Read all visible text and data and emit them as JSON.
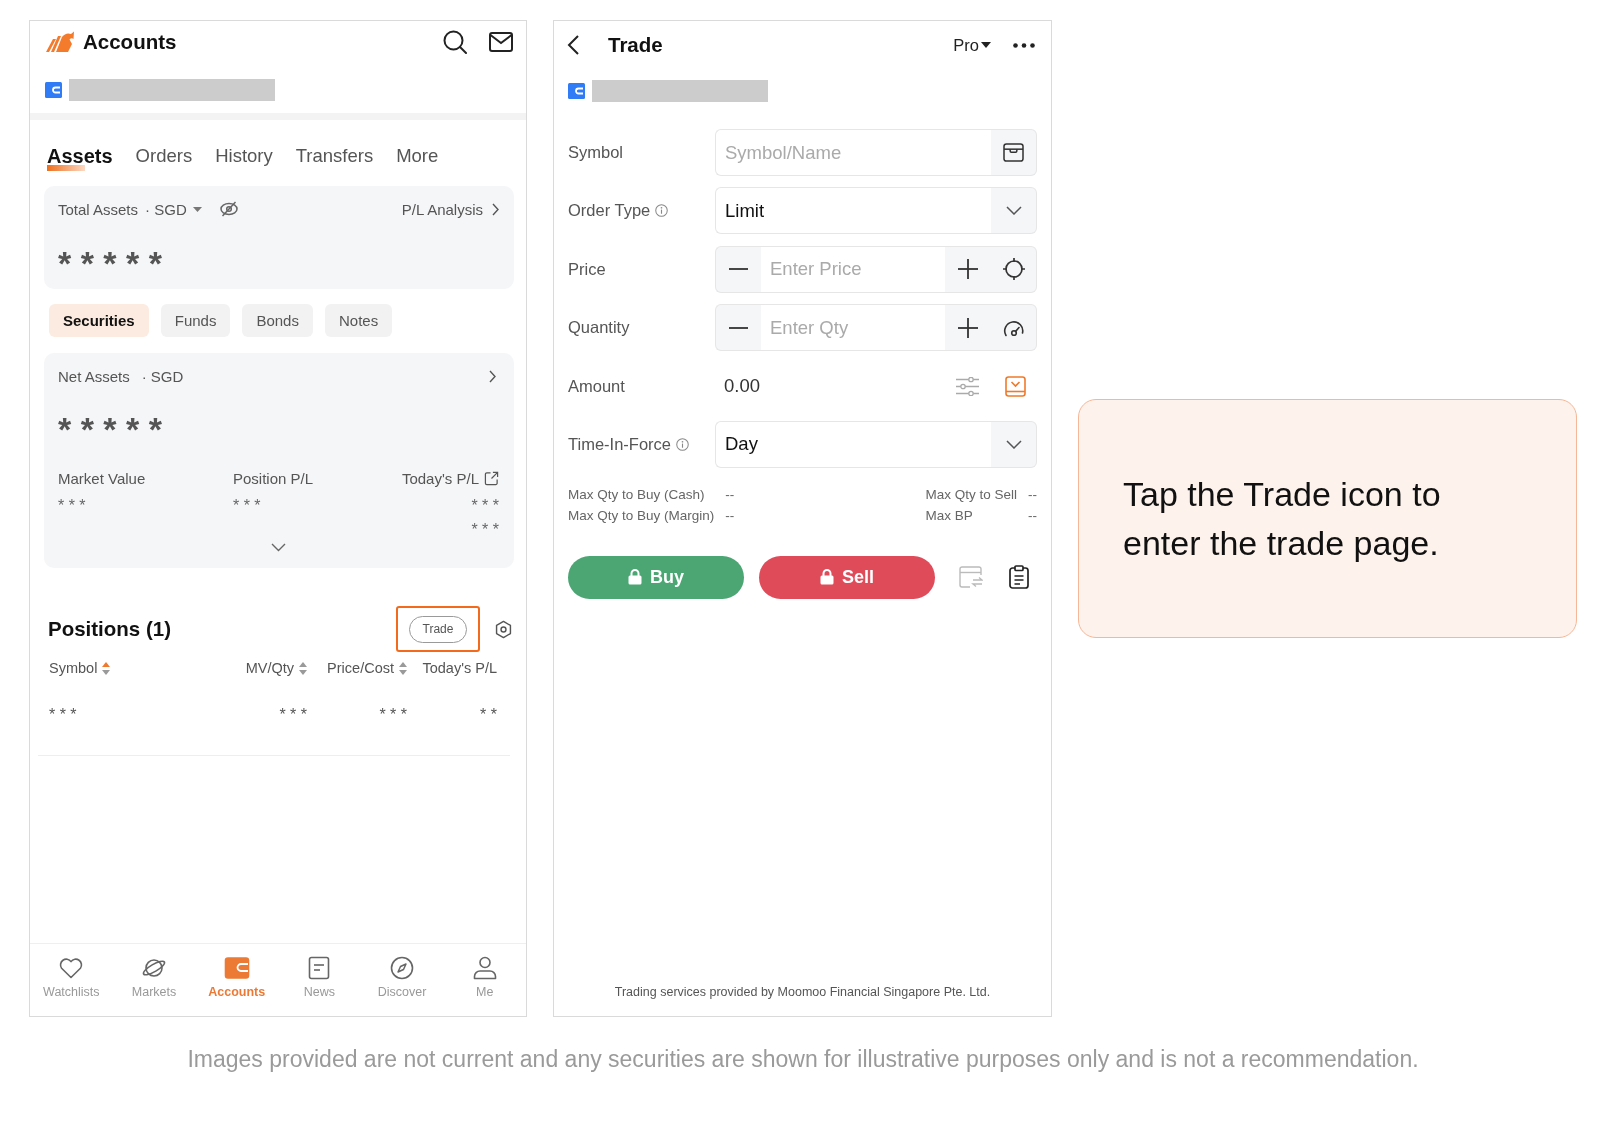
{
  "accounts_screen": {
    "title": "Accounts",
    "tabs": [
      {
        "label": "Assets",
        "selected": true
      },
      {
        "label": "Orders",
        "selected": false
      },
      {
        "label": "History",
        "selected": false
      },
      {
        "label": "Transfers",
        "selected": false
      },
      {
        "label": "More",
        "selected": false
      }
    ],
    "total_assets": {
      "label": "Total Assets",
      "currency": "· SGD",
      "link": "P/L Analysis",
      "value": "* * * * *"
    },
    "asset_types": [
      {
        "label": "Securities",
        "selected": true
      },
      {
        "label": "Funds",
        "selected": false
      },
      {
        "label": "Bonds",
        "selected": false
      },
      {
        "label": "Notes",
        "selected": false
      }
    ],
    "net_assets": {
      "label": "Net Assets",
      "currency": "· SGD",
      "value": "* * * * *",
      "metrics": [
        {
          "label": "Market Value",
          "values": [
            "* * *"
          ]
        },
        {
          "label": "Position P/L",
          "values": [
            "* * *"
          ]
        },
        {
          "label": "Today's P/L",
          "values": [
            "* * *",
            "* * *"
          ]
        }
      ]
    },
    "positions": {
      "title": "Positions (1)",
      "trade_button": {
        "label": "Trade",
        "highlighted": true
      },
      "columns": [
        {
          "label": "Symbol",
          "sortable": true,
          "sorted": true
        },
        {
          "label": "MV/Qty",
          "sortable": true,
          "sorted": false
        },
        {
          "label": "Price/Cost",
          "sortable": true,
          "sorted": false
        },
        {
          "label": "Today's P/L",
          "sortable": false
        }
      ],
      "rows": [
        [
          "* * *",
          "* * *",
          "* * *",
          "* *"
        ]
      ]
    },
    "tab_bar": [
      {
        "label": "Watchlists",
        "selected": false
      },
      {
        "label": "Markets",
        "selected": false
      },
      {
        "label": "Accounts",
        "selected": true
      },
      {
        "label": "News",
        "selected": false
      },
      {
        "label": "Discover",
        "selected": false
      },
      {
        "label": "Me",
        "selected": false
      }
    ]
  },
  "trade_screen": {
    "title": "Trade",
    "mode": "Pro",
    "form": [
      {
        "kind": "search",
        "label": "Symbol",
        "info": false,
        "placeholder": "Symbol/Name"
      },
      {
        "kind": "select",
        "label": "Order Type",
        "info": true,
        "value": "Limit"
      },
      {
        "kind": "price",
        "label": "Price",
        "info": false,
        "placeholder": "Enter Price"
      },
      {
        "kind": "quantity",
        "label": "Quantity",
        "info": false,
        "placeholder": "Enter Qty"
      },
      {
        "kind": "amount",
        "label": "Amount",
        "info": false,
        "value": "0.00"
      },
      {
        "kind": "select",
        "label": "Time-In-Force",
        "info": true,
        "value": "Day"
      }
    ],
    "limit_rows": [
      [
        "Max Qty to Buy (Cash)",
        "--",
        "Max Qty to Sell",
        "--"
      ],
      [
        "Max Qty to Buy (Margin)",
        "--",
        "Max BP",
        "--"
      ]
    ],
    "actions": [
      {
        "kind": "buy",
        "label": "Buy",
        "locked": true
      },
      {
        "kind": "sell",
        "label": "Sell",
        "locked": true
      }
    ],
    "footer": "Trading services provided by Moomoo Financial Singapore Pte. Ltd."
  },
  "callout": {
    "text": "Tap the Trade icon to enter the trade page."
  },
  "disclaimer": "Images provided are not current and any securities are shown for illustrative purposes only and is not a recommendation."
}
